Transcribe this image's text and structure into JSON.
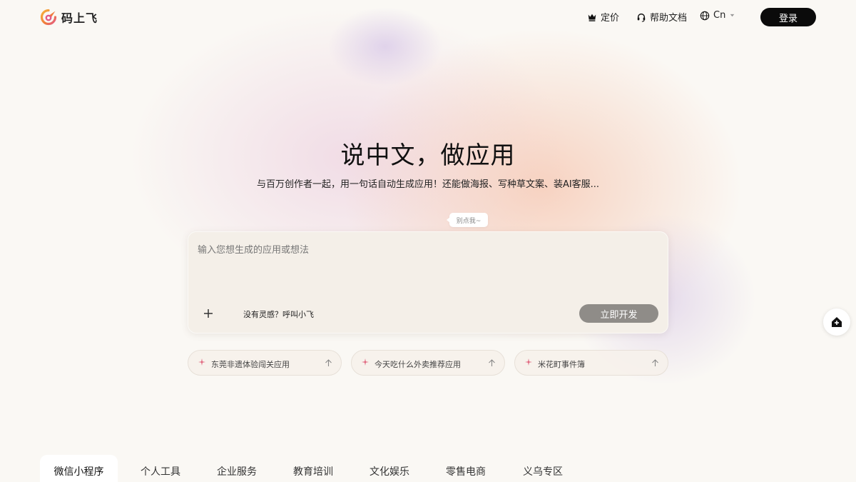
{
  "header": {
    "brand": "码上飞",
    "nav": {
      "pricing": "定价",
      "docs": "帮助文档",
      "lang": "Cn"
    },
    "login": "登录"
  },
  "hero": {
    "title": "说中文，做应用",
    "subtitle": "与百万创作者一起，用一句话自动生成应用！还能做海报、写种草文案、装AI客服..."
  },
  "tip": "别点我~",
  "prompt": {
    "placeholder": "输入您想生成的应用或想法",
    "value": "",
    "inspire": "没有灵感？呼叫小飞",
    "submit": "立即开发"
  },
  "suggestions": [
    {
      "label": "东莞非遗体验闯关应用"
    },
    {
      "label": "今天吃什么外卖推荐应用"
    },
    {
      "label": "米花町事件簿"
    }
  ],
  "tabs": [
    {
      "label": "微信小程序",
      "active": true
    },
    {
      "label": "个人工具"
    },
    {
      "label": "企业服务"
    },
    {
      "label": "教育培训"
    },
    {
      "label": "文化娱乐"
    },
    {
      "label": "零售电商"
    },
    {
      "label": "义乌专区"
    }
  ],
  "colors": {
    "accent_dark": "#0b0b0b",
    "submit_disabled": "#8f8c88",
    "spark": "#e0607a",
    "logo_orange": "#f39a3c",
    "logo_pink": "#e15a8a"
  }
}
